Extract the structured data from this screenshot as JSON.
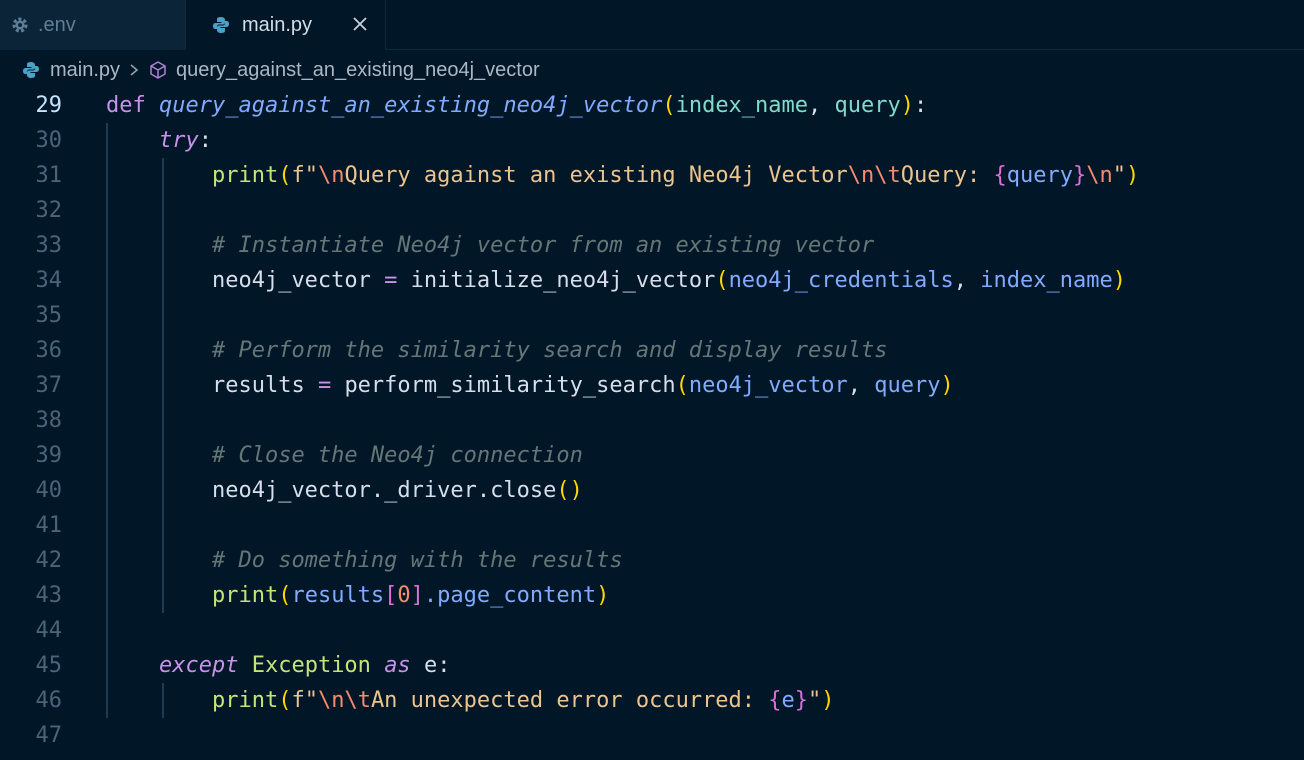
{
  "tabs": [
    {
      "label": ".env",
      "active": false,
      "icon": "gear-icon"
    },
    {
      "label": "main.py",
      "active": true,
      "icon": "python-icon"
    }
  ],
  "breadcrumb": {
    "file": "main.py",
    "symbol": "query_against_an_existing_neo4j_vector"
  },
  "editor": {
    "current_line": 29,
    "lines": [
      {
        "n": "29",
        "tokens": [
          [
            "kw",
            "def"
          ],
          [
            "punc",
            " "
          ],
          [
            "fn",
            "query_against_an_existing_neo4j_vector"
          ],
          [
            "br1",
            "("
          ],
          [
            "param",
            "index_name"
          ],
          [
            "punc",
            ", "
          ],
          [
            "param",
            "query"
          ],
          [
            "br1",
            ")"
          ],
          [
            "punc",
            ":"
          ]
        ]
      },
      {
        "n": "30",
        "tokens": [
          [
            "punc",
            "    "
          ],
          [
            "kwi",
            "try"
          ],
          [
            "punc",
            ":"
          ]
        ]
      },
      {
        "n": "31",
        "tokens": [
          [
            "punc",
            "        "
          ],
          [
            "call",
            "print"
          ],
          [
            "br1",
            "("
          ],
          [
            "str",
            "f\""
          ],
          [
            "esc",
            "\\n"
          ],
          [
            "str",
            "Query against an existing Neo4j Vector"
          ],
          [
            "esc",
            "\\n\\t"
          ],
          [
            "str",
            "Query: "
          ],
          [
            "br2",
            "{"
          ],
          [
            "interp",
            "query"
          ],
          [
            "br2",
            "}"
          ],
          [
            "esc",
            "\\n"
          ],
          [
            "str",
            "\""
          ],
          [
            "br1",
            ")"
          ]
        ]
      },
      {
        "n": "32",
        "tokens": []
      },
      {
        "n": "33",
        "tokens": [
          [
            "punc",
            "        "
          ],
          [
            "cm",
            "# Instantiate Neo4j vector from an existing vector"
          ]
        ]
      },
      {
        "n": "34",
        "tokens": [
          [
            "punc",
            "        "
          ],
          [
            "var",
            "neo4j_vector"
          ],
          [
            "punc",
            " "
          ],
          [
            "op",
            "="
          ],
          [
            "punc",
            " "
          ],
          [
            "var",
            "initialize_neo4j_vector"
          ],
          [
            "br1",
            "("
          ],
          [
            "arg",
            "neo4j_credentials"
          ],
          [
            "punc",
            ", "
          ],
          [
            "arg",
            "index_name"
          ],
          [
            "br1",
            ")"
          ]
        ]
      },
      {
        "n": "35",
        "tokens": []
      },
      {
        "n": "36",
        "tokens": [
          [
            "punc",
            "        "
          ],
          [
            "cm",
            "# Perform the similarity search and display results"
          ]
        ]
      },
      {
        "n": "37",
        "tokens": [
          [
            "punc",
            "        "
          ],
          [
            "var",
            "results"
          ],
          [
            "punc",
            " "
          ],
          [
            "op",
            "="
          ],
          [
            "punc",
            " "
          ],
          [
            "var",
            "perform_similarity_search"
          ],
          [
            "br1",
            "("
          ],
          [
            "arg",
            "neo4j_vector"
          ],
          [
            "punc",
            ", "
          ],
          [
            "arg",
            "query"
          ],
          [
            "br1",
            ")"
          ]
        ]
      },
      {
        "n": "38",
        "tokens": []
      },
      {
        "n": "39",
        "tokens": [
          [
            "punc",
            "        "
          ],
          [
            "cm",
            "# Close the Neo4j connection"
          ]
        ]
      },
      {
        "n": "40",
        "tokens": [
          [
            "punc",
            "        "
          ],
          [
            "var",
            "neo4j_vector"
          ],
          [
            "punc",
            "."
          ],
          [
            "var",
            "_driver"
          ],
          [
            "punc",
            "."
          ],
          [
            "method",
            "close"
          ],
          [
            "br1",
            "()"
          ]
        ]
      },
      {
        "n": "41",
        "tokens": []
      },
      {
        "n": "42",
        "tokens": [
          [
            "punc",
            "        "
          ],
          [
            "cm",
            "# Do something with the results"
          ]
        ]
      },
      {
        "n": "43",
        "tokens": [
          [
            "punc",
            "        "
          ],
          [
            "call",
            "print"
          ],
          [
            "br1",
            "("
          ],
          [
            "attr",
            "results"
          ],
          [
            "br2",
            "["
          ],
          [
            "num",
            "0"
          ],
          [
            "br2",
            "]"
          ],
          [
            "attr",
            ".page_content"
          ],
          [
            "br1",
            ")"
          ]
        ]
      },
      {
        "n": "44",
        "tokens": []
      },
      {
        "n": "45",
        "tokens": [
          [
            "punc",
            "    "
          ],
          [
            "kwi",
            "except"
          ],
          [
            "punc",
            " "
          ],
          [
            "cls",
            "Exception"
          ],
          [
            "punc",
            " "
          ],
          [
            "kwi",
            "as"
          ],
          [
            "punc",
            " "
          ],
          [
            "var",
            "e"
          ],
          [
            "punc",
            ":"
          ]
        ]
      },
      {
        "n": "46",
        "tokens": [
          [
            "punc",
            "        "
          ],
          [
            "call",
            "print"
          ],
          [
            "br1",
            "("
          ],
          [
            "str",
            "f\""
          ],
          [
            "esc",
            "\\n\\t"
          ],
          [
            "str",
            "An unexpected error occurred: "
          ],
          [
            "br2",
            "{"
          ],
          [
            "interp",
            "e"
          ],
          [
            "br2",
            "}"
          ],
          [
            "str",
            "\""
          ],
          [
            "br1",
            ")"
          ]
        ]
      },
      {
        "n": "47",
        "tokens": []
      }
    ]
  },
  "colors": {
    "background": "#011627",
    "keyword": "#c792ea",
    "function": "#82aaff",
    "parameter": "#7fdbca",
    "string": "#ecc48d",
    "comment": "#637777",
    "call": "#c5e478"
  }
}
